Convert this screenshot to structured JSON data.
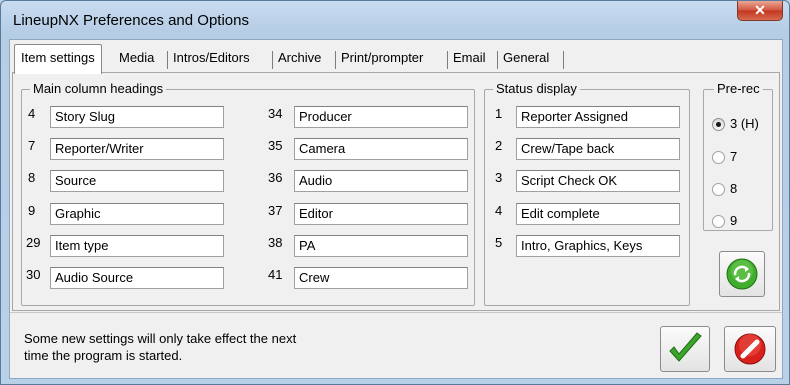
{
  "window": {
    "title": "LineupNX Preferences and Options",
    "close_label": "✕"
  },
  "tabs": [
    {
      "label": "Item settings",
      "selected": true
    },
    {
      "label": "Media"
    },
    {
      "label": "Intros/Editors"
    },
    {
      "label": "Archive"
    },
    {
      "label": "Print/prompter"
    },
    {
      "label": "Email"
    },
    {
      "label": "General"
    }
  ],
  "main_columns": {
    "title": "Main column headings",
    "left": [
      {
        "num": "4",
        "value": "Story Slug"
      },
      {
        "num": "7",
        "value": "Reporter/Writer"
      },
      {
        "num": "8",
        "value": "Source"
      },
      {
        "num": "9",
        "value": "Graphic"
      },
      {
        "num": "29",
        "value": "Item type"
      },
      {
        "num": "30",
        "value": "Audio Source"
      }
    ],
    "right": [
      {
        "num": "34",
        "value": "Producer"
      },
      {
        "num": "35",
        "value": "Camera"
      },
      {
        "num": "36",
        "value": "Audio"
      },
      {
        "num": "37",
        "value": "Editor"
      },
      {
        "num": "38",
        "value": "PA"
      },
      {
        "num": "41",
        "value": "Crew"
      }
    ]
  },
  "status_display": {
    "title": "Status display",
    "items": [
      {
        "num": "1",
        "value": "Reporter Assigned"
      },
      {
        "num": "2",
        "value": "Crew/Tape back"
      },
      {
        "num": "3",
        "value": "Script Check OK"
      },
      {
        "num": "4",
        "value": "Edit complete"
      },
      {
        "num": "5",
        "value": "Intro, Graphics, Keys"
      }
    ]
  },
  "prerec": {
    "title": "Pre-rec",
    "options": [
      {
        "label": "3 (H)",
        "checked": true
      },
      {
        "label": "7",
        "checked": false
      },
      {
        "label": "8",
        "checked": false
      },
      {
        "label": "9",
        "checked": false
      }
    ]
  },
  "footer": {
    "line1": "Some new settings will only take effect the next",
    "line2": "time the program is started."
  },
  "icons": {
    "refresh": "refresh-icon",
    "ok": "checkmark-icon",
    "cancel": "cancel-icon"
  },
  "colors": {
    "ok_green": "#3aa52a",
    "cancel_red": "#d8201c",
    "refresh_green": "#3fae2c"
  }
}
